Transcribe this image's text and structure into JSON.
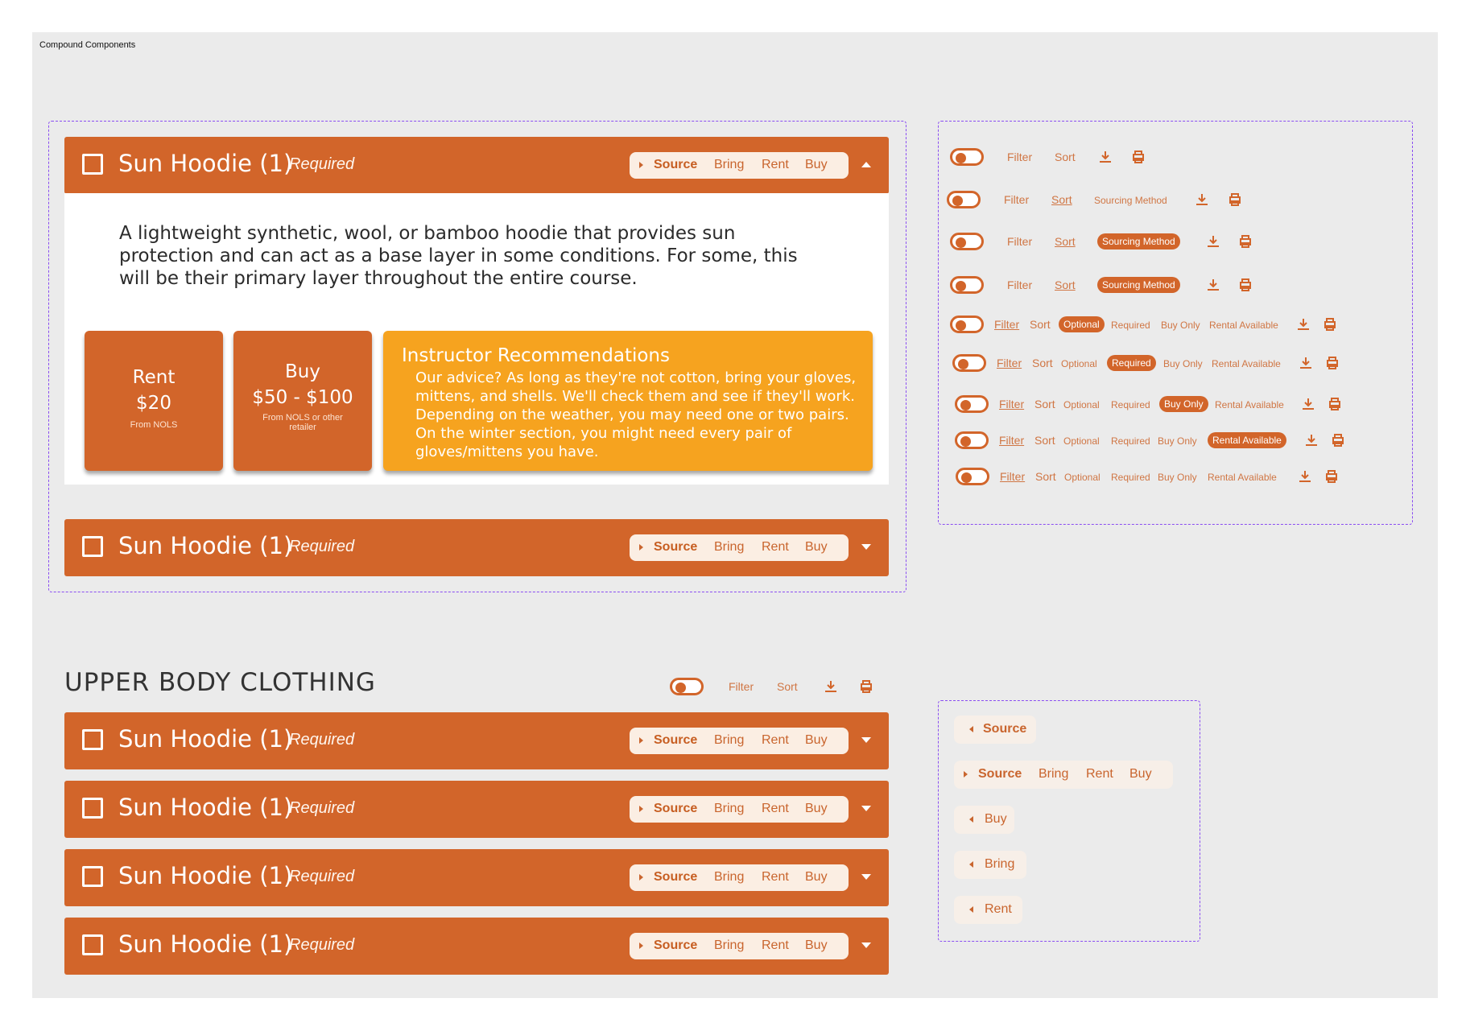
{
  "frame_label": "Compound Components",
  "accordion": {
    "title": "Sun Hoodie (1)",
    "required": "Required",
    "source": "Source",
    "bring": "Bring",
    "rent": "Rent",
    "buy": "Buy"
  },
  "expanded": {
    "description": "A lightweight synthetic, wool, or bamboo hoodie that provides sun protection and can act as a base layer in some conditions. For some, this will be their primary layer throughout the entire course.",
    "rent_card": {
      "label": "Rent",
      "price": "$20",
      "note": "From NOLS"
    },
    "buy_card": {
      "label": "Buy",
      "price": "$50 - $100",
      "note": "From NOLS or other retailer"
    },
    "recommendation": {
      "title": "Instructor Recommendations",
      "body": "Our advice? As long as they're not cotton, bring your gloves, mittens, and shells. We'll check them and see if they'll work. Depending on the weather, you may need one or two pairs. On the winter section, you might need every pair of gloves/mittens you have."
    }
  },
  "section": {
    "heading": "UPPER BODY CLOTHING"
  },
  "toolbar": {
    "filter": "Filter",
    "sort": "Sort",
    "sourcing_method": "Sourcing Method",
    "optional": "Optional",
    "required": "Required",
    "buy_only": "Buy Only",
    "rental_available": "Rental Available"
  },
  "colors": {
    "primary": "#d2652a",
    "accent": "#f6a31f",
    "pill_bg": "#fbeee3",
    "canvas": "#ebebeb",
    "dash": "#8a4df2"
  },
  "icons": [
    "download-icon",
    "print-icon",
    "toggle-switch",
    "checkbox-icon",
    "caret-right-icon",
    "caret-left-icon",
    "chevron-up-icon",
    "chevron-down-icon"
  ]
}
